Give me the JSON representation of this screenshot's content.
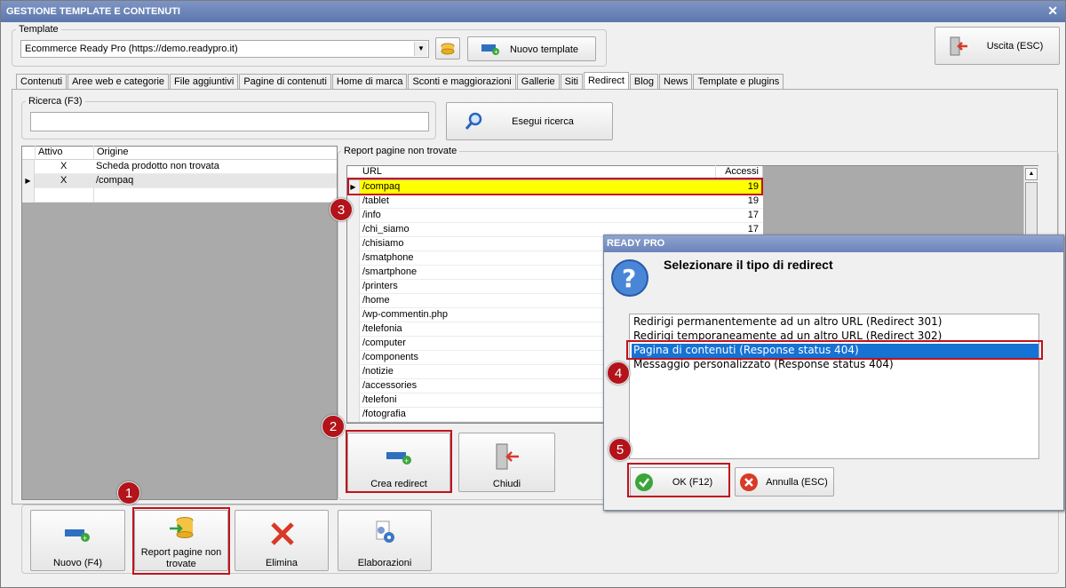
{
  "window": {
    "title": "GESTIONE TEMPLATE E CONTENUTI",
    "close": "✕"
  },
  "template": {
    "label": "Template",
    "value": "Ecommerce Ready Pro (https://demo.readypro.it)",
    "new_button": "Nuovo template"
  },
  "exit_button": "Uscita (ESC)",
  "tabs": [
    "Contenuti",
    "Aree web e categorie",
    "File aggiuntivi",
    "Pagine di contenuti",
    "Home di marca",
    "Sconti e maggiorazioni",
    "Gallerie",
    "Siti",
    "Redirect",
    "Blog",
    "News",
    "Template e plugins"
  ],
  "active_tab": "Redirect",
  "search": {
    "label": "Ricerca (F3)",
    "value": "",
    "button": "Esegui ricerca"
  },
  "redirect_grid": {
    "headers": [
      "Attivo",
      "Origine"
    ],
    "rows": [
      {
        "attivo": "X",
        "origine": "Scheda prodotto non trovata"
      },
      {
        "attivo": "X",
        "origine": "/compaq"
      },
      {
        "attivo": "",
        "origine": ""
      }
    ]
  },
  "report": {
    "title": "Report pagine non trovate",
    "headers": [
      "URL",
      "Accessi"
    ],
    "rows": [
      {
        "url": "/compaq",
        "accessi": "19"
      },
      {
        "url": "/tablet",
        "accessi": "19"
      },
      {
        "url": "/info",
        "accessi": "17"
      },
      {
        "url": "/chi_siamo",
        "accessi": "17"
      },
      {
        "url": "/chisiamo",
        "accessi": ""
      },
      {
        "url": "/smatphone",
        "accessi": ""
      },
      {
        "url": "/smartphone",
        "accessi": ""
      },
      {
        "url": "/printers",
        "accessi": ""
      },
      {
        "url": "/home",
        "accessi": ""
      },
      {
        "url": "/wp-commentin.php",
        "accessi": ""
      },
      {
        "url": "/telefonia",
        "accessi": ""
      },
      {
        "url": "/computer",
        "accessi": ""
      },
      {
        "url": "/components",
        "accessi": ""
      },
      {
        "url": "/notizie",
        "accessi": ""
      },
      {
        "url": "/accessories",
        "accessi": ""
      },
      {
        "url": "/telefoni",
        "accessi": ""
      },
      {
        "url": "/fotografia",
        "accessi": ""
      }
    ],
    "create_button": "Crea redirect",
    "close_button": "Chiudi"
  },
  "bottom_buttons": {
    "new": "Nuovo (F4)",
    "report": "Report pagine non trovate",
    "delete": "Elimina",
    "process": "Elaborazioni"
  },
  "dialog": {
    "title": "READY PRO",
    "question": "Selezionare il tipo di redirect",
    "options": [
      "Redirigi permanentemente ad un altro URL (Redirect 301)",
      "Redirigi temporaneamente ad un altro URL (Redirect 302)",
      "Pagina di contenuti (Response status 404)",
      "Messaggio personalizzato (Response status 404)"
    ],
    "selected_option": "Pagina di contenuti (Response status 404)",
    "ok": "OK (F12)",
    "cancel": "Annulla (ESC)"
  },
  "step_badges": [
    "1",
    "2",
    "3",
    "4",
    "5"
  ],
  "colors": {
    "title_bar": "#5c77ad",
    "highlight_row": "#ffff00",
    "selection": "#1672d4",
    "annotation": "#c0121c"
  }
}
